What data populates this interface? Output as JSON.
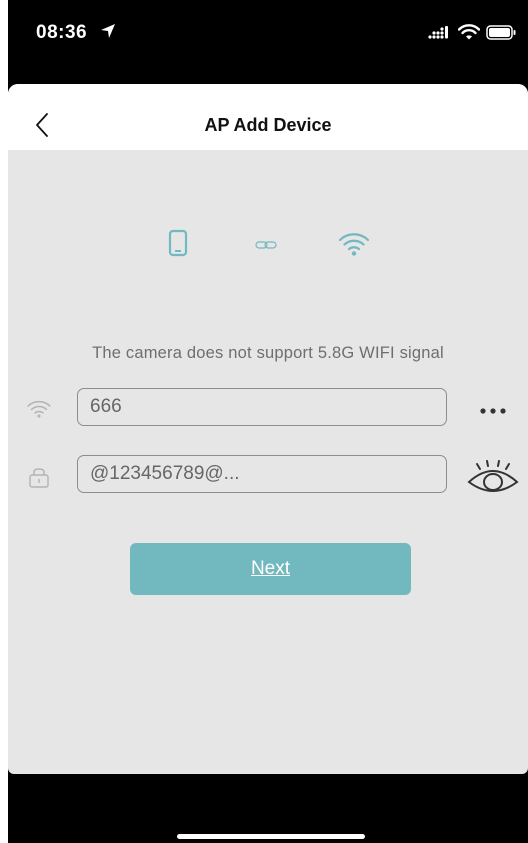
{
  "status_bar": {
    "time": "08:36",
    "icons": [
      "location-arrow-icon",
      "cellular-signal-icon",
      "wifi-icon",
      "battery-icon"
    ]
  },
  "nav": {
    "title": "AP Add Device",
    "back_icon": "chevron-left-icon"
  },
  "steps": {
    "icons": [
      "phone-icon",
      "link-icon",
      "wifi-icon"
    ],
    "accent_color": "#72b8bf"
  },
  "notice": "The camera does not support 5.8G WIFI signal",
  "wifi_row": {
    "icon": "wifi-icon",
    "value": "666",
    "action_icon": "more-dots-icon"
  },
  "password_row": {
    "icon": "lock-icon",
    "value": "@123456789@...",
    "action_icon": "eye-icon"
  },
  "next_button": {
    "label": "Next",
    "color": "#72b8bf"
  },
  "colors": {
    "background": "#e6e6e6",
    "nav_background": "#ffffff",
    "text_muted": "#6e6e6e"
  }
}
